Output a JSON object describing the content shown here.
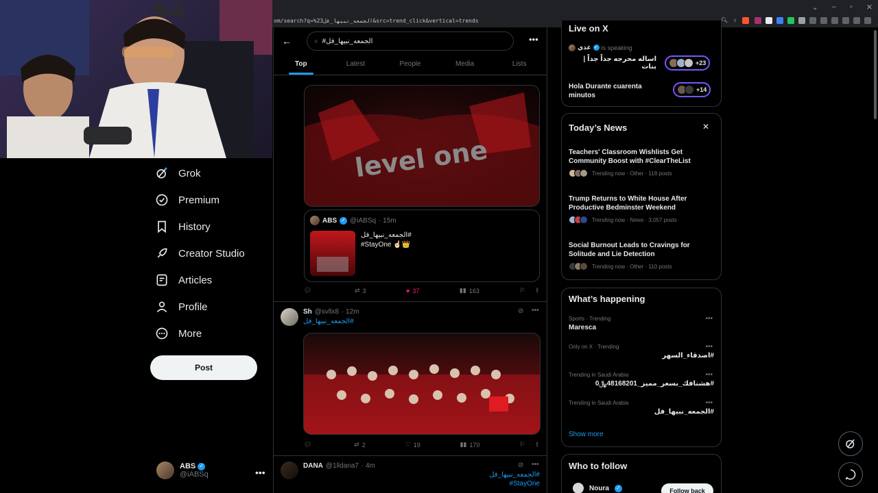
{
  "browser": {
    "url": "om/search?q=%23الجمعه_نبيها_فل&src=trend_click&vertical=trends"
  },
  "nav": {
    "items": [
      {
        "label": "Grok",
        "icon": "grok-icon"
      },
      {
        "label": "Premium",
        "icon": "premium-icon"
      },
      {
        "label": "History",
        "icon": "bookmark-icon"
      },
      {
        "label": "Creator Studio",
        "icon": "rocket-icon"
      },
      {
        "label": "Articles",
        "icon": "articles-icon"
      },
      {
        "label": "Profile",
        "icon": "person-icon"
      },
      {
        "label": "More",
        "icon": "more-circle-icon"
      }
    ],
    "post_label": "Post",
    "account": {
      "name": "ABS",
      "handle": "@iABSq"
    }
  },
  "search": {
    "query": "#الجمعه_نبيها_فل",
    "tabs": [
      "Top",
      "Latest",
      "People",
      "Media",
      "Lists"
    ],
    "active_tab": "Top"
  },
  "tweets": [
    {
      "media_text": "level one",
      "quote": {
        "name": "ABS",
        "handle": "@iABSq",
        "time": "· 15m",
        "line1": "#الجمعه_نبيها_فل",
        "line2": "#StayOne ☝🏻👑"
      },
      "stats": {
        "replies": "",
        "reposts": "3",
        "likes": "37",
        "views": "163"
      }
    },
    {
      "name": "Sh",
      "handle": "@svllx8",
      "time": "· 12m",
      "text": "#الجمعه_نبيها_فل",
      "stats": {
        "replies": "",
        "reposts": "2",
        "likes": "19",
        "views": "170"
      }
    },
    {
      "name": "DANA",
      "handle": "@1lldana7",
      "time": "· 4m",
      "line1": "#الجمعه_نبيها_فل",
      "line2": "#StayOne"
    }
  ],
  "live": {
    "title": "Live on X",
    "speaker": "غذي",
    "speaking_label": "is speaking",
    "space1": {
      "title": "اساله محرجه جداً جداً | بنات",
      "count": "+23"
    },
    "space2": {
      "title": "Hola Durante cuarenta minutos",
      "count": "+14"
    }
  },
  "news": {
    "title": "Today’s News",
    "items": [
      {
        "title": "Teachers' Classroom Wishlists Get Community Boost with #ClearTheList",
        "meta": "Trending now · Other · 118 posts"
      },
      {
        "title": "Trump Returns to White House After Productive Bedminster Weekend",
        "meta": "Trending now · News · 3,057 posts"
      },
      {
        "title": "Social Burnout Leads to Cravings for Solitude and Lie Detection",
        "meta": "Trending now · Other · 110 posts"
      }
    ]
  },
  "happening": {
    "title": "What’s happening",
    "items": [
      {
        "context": "Sports · Trending",
        "name": "Maresca"
      },
      {
        "context": "Only on X · Trending",
        "name": "#اصدقاء_السهر"
      },
      {
        "context": "Trending in Saudi Arabia",
        "name": "#هشنافك_بسعر_مميز_48168201﷼0"
      },
      {
        "context": "Trending in Saudi Arabia",
        "name": "#الجمعه_نبيها_فل"
      }
    ],
    "show_more": "Show more"
  },
  "follow": {
    "title": "Who to follow",
    "user": "Noura",
    "button": "Follow back"
  },
  "colors": {
    "accent": "#1d9bf0",
    "like": "#f91880",
    "spaces": "#7856ff"
  }
}
